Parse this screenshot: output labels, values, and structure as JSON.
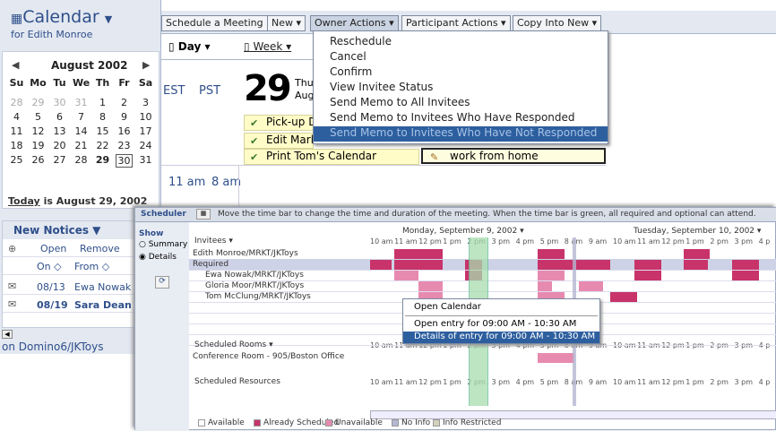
{
  "sidebar": {
    "title": "Calendar",
    "subtitle": "for Edith Monroe",
    "month_label": "August 2002",
    "weekday_headers": [
      "Su",
      "Mo",
      "Tu",
      "We",
      "Th",
      "Fr",
      "Sa"
    ],
    "weeks": [
      [
        "28",
        "29",
        "30",
        "31",
        "1",
        "2",
        "3"
      ],
      [
        "4",
        "5",
        "6",
        "7",
        "8",
        "9",
        "10"
      ],
      [
        "11",
        "12",
        "13",
        "14",
        "15",
        "16",
        "17"
      ],
      [
        "18",
        "19",
        "20",
        "21",
        "22",
        "23",
        "24"
      ],
      [
        "25",
        "26",
        "27",
        "28",
        "29",
        "30",
        "31"
      ]
    ],
    "today_link": "Today",
    "today_text": "is August 29, 2002",
    "notices_title": "New Notices",
    "notices_open": "Open",
    "notices_remove": "Remove",
    "notices_col_on": "On",
    "notices_col_from": "From",
    "notices": [
      {
        "date": "08/13",
        "from": "Ewa Nowak"
      },
      {
        "date": "08/19",
        "from": "Sara Dean"
      }
    ],
    "server": "on Domino6/JKToys"
  },
  "toolbar": {
    "schedule_meeting": "Schedule a Meeting",
    "new": "New",
    "owner_actions": "Owner Actions",
    "participant_actions": "Participant Actions",
    "copy_into_new": "Copy Into New"
  },
  "dayview": {
    "tab_day": "Day",
    "tab_week": "Week",
    "tz1": "EST",
    "tz2": "PST",
    "date_num": "29",
    "date_day": "Thu",
    "date_month": "Aug",
    "appts": [
      "Pick-up D",
      "Edit Mark",
      "Print Tom's Calendar"
    ],
    "appt_right": "work from home",
    "time1": "11 am",
    "time2": "8 am"
  },
  "owner_menu": {
    "items": [
      "Reschedule",
      "Cancel",
      "Confirm",
      "View Invitee Status",
      "Send Memo to All Invitees",
      "Send Memo to Invitees Who Have Responded",
      "Send Memo to Invitees Who Have Not Responded"
    ]
  },
  "scheduler": {
    "title": "Scheduler",
    "hint": "Move the time bar to change the time and duration of the meeting.  When the time bar is green, all required and optional can attend.",
    "show_label": "Show",
    "opt_summary": "Summary",
    "opt_details": "Details",
    "invitees_label": "Invitees",
    "day1": "Monday, September 9, 2002",
    "day2": "Tuesday, September 10, 2002",
    "hours": [
      "10 am",
      "11 am",
      "12 pm",
      "1 pm",
      "2 pm",
      "3 pm",
      "4 pm",
      "5 pm",
      "8 am",
      "9 am",
      "10 am",
      "11 am",
      "12 pm",
      "1 pm",
      "2 pm",
      "3 pm",
      "4 p"
    ],
    "chair": "Edith Monroe/MRKT/JKToys",
    "required": "Required",
    "people": [
      "Ewa Nowak/MRKT/JKToys",
      "Gloria Moor/MRKT/JKToys",
      "Tom McClung/MRKT/JKToys"
    ],
    "rooms_label": "Scheduled Rooms",
    "room": "Conference Room - 905/Boston Office",
    "resources_label": "Scheduled Resources",
    "legend": [
      "Available",
      "Already Scheduled",
      "Unavailable",
      "No Info",
      "Info Restricted"
    ],
    "colors": {
      "available": "#ffffff",
      "scheduled": "#c8336a",
      "unavailable": "#e78ab0",
      "noinfo": "#b5b7d2",
      "restricted": "#d4d1bd",
      "timebar": "#a8ddae"
    }
  },
  "context_menu": {
    "items": [
      "Open Calendar",
      "Open entry for 09:00 AM - 10:30 AM",
      "Details of entry for 09:00 AM - 10:30 AM"
    ]
  }
}
